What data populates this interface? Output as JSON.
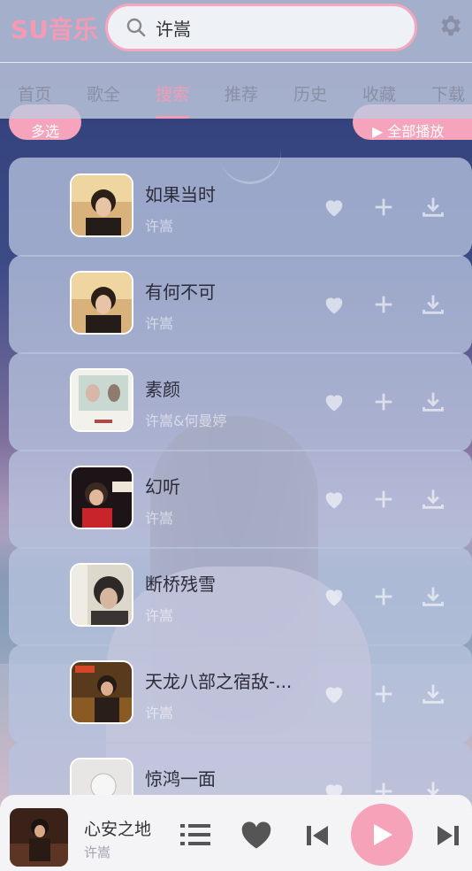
{
  "app": {
    "logo": "SU音乐"
  },
  "search": {
    "value": "许嵩"
  },
  "tabs": [
    {
      "label": "首页",
      "active": false
    },
    {
      "label": "歌全",
      "active": false
    },
    {
      "label": "搜索",
      "active": true
    },
    {
      "label": "推荐",
      "active": false
    },
    {
      "label": "历史",
      "active": false
    },
    {
      "label": "收藏",
      "active": false
    },
    {
      "label": "下载",
      "active": false
    }
  ],
  "actions": {
    "multi_select": "多选",
    "play_all": "全部播放"
  },
  "songs": [
    {
      "title": "如果当时",
      "artist": "许嵩"
    },
    {
      "title": "有何不可",
      "artist": "许嵩"
    },
    {
      "title": "素颜",
      "artist": "许嵩&何曼婷"
    },
    {
      "title": "幻听",
      "artist": "许嵩"
    },
    {
      "title": "断桥残雪",
      "artist": "许嵩"
    },
    {
      "title": "天龙八部之宿敌-...",
      "artist": "许嵩"
    },
    {
      "title": "惊鸿一面",
      "artist": ""
    }
  ],
  "now_playing": {
    "title": "心安之地",
    "artist": "许嵩"
  },
  "colors": {
    "accent": "#f6a4bc",
    "header_bg": "#bec8de",
    "card_bg": "#b7c3de"
  },
  "icons": [
    "search-icon",
    "gear-icon",
    "heart-icon",
    "plus-icon",
    "download-icon",
    "playlist-icon",
    "prev-icon",
    "play-icon",
    "next-icon"
  ]
}
